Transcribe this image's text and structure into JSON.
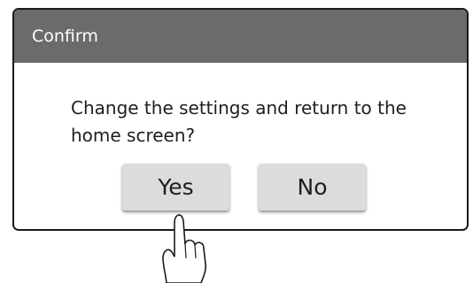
{
  "dialog": {
    "title": "Confirm",
    "message": "Change the settings and return to the home screen?",
    "buttons": {
      "yes_label": "Yes",
      "no_label": "No"
    }
  },
  "colors": {
    "header_background": "#6b6b6b",
    "header_text": "#ffffff",
    "button_background": "#dcdcdc",
    "dialog_border": "#1a1a1a"
  },
  "icons": {
    "pointer": "pointing-hand-icon"
  }
}
